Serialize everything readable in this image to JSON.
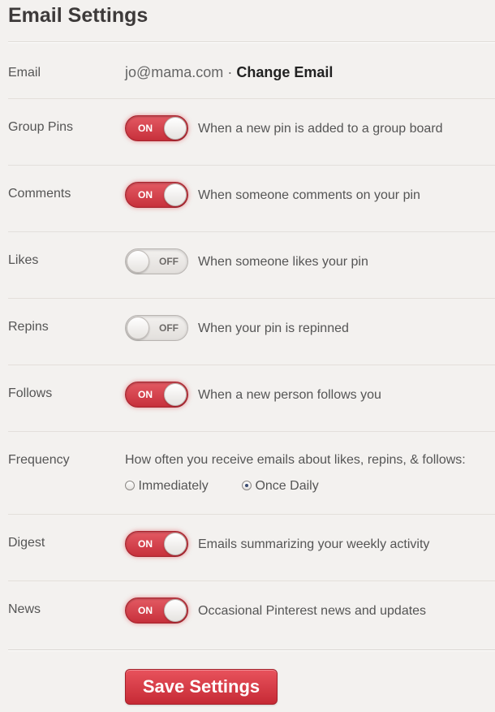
{
  "page_title": "Email Settings",
  "email": {
    "label": "Email",
    "value": "jo@mama.com",
    "separator": "·",
    "change_label": "Change Email"
  },
  "settings": [
    {
      "label": "Group Pins",
      "state": "ON",
      "description": "When a new pin is added to a group board"
    },
    {
      "label": "Comments",
      "state": "ON",
      "description": "When someone comments on your pin"
    },
    {
      "label": "Likes",
      "state": "OFF",
      "description": "When someone likes your pin"
    },
    {
      "label": "Repins",
      "state": "OFF",
      "description": "When your pin is repinned"
    },
    {
      "label": "Follows",
      "state": "ON",
      "description": "When a new person follows you"
    }
  ],
  "frequency": {
    "label": "Frequency",
    "description": "How often you receive emails about likes, repins, & follows:",
    "options": [
      {
        "label": "Immediately",
        "selected": false
      },
      {
        "label": "Once Daily",
        "selected": true
      }
    ]
  },
  "digest": {
    "label": "Digest",
    "state": "ON",
    "description": "Emails summarizing your weekly activity"
  },
  "news": {
    "label": "News",
    "state": "ON",
    "description": "Occasional Pinterest news and updates"
  },
  "save_label": "Save Settings",
  "colors": {
    "accent": "#cb333d",
    "background": "#f3f1ef"
  }
}
